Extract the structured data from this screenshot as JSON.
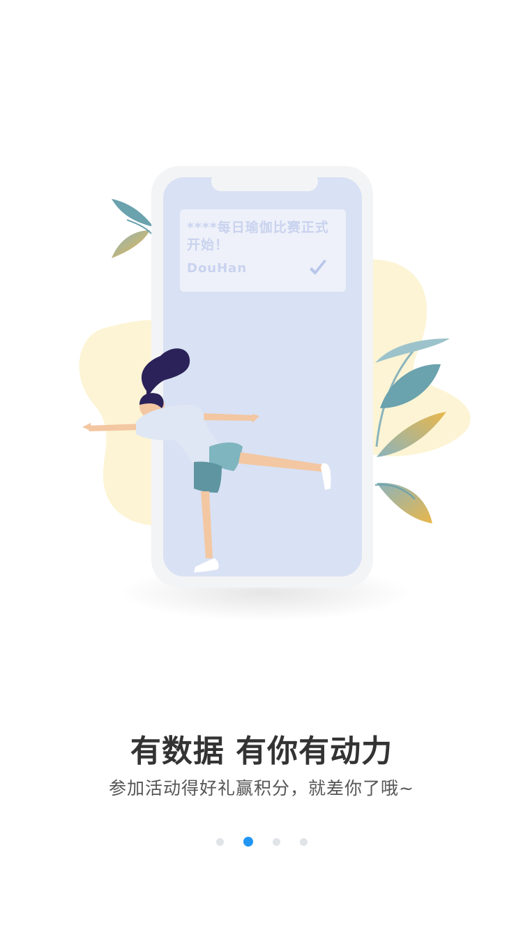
{
  "illustration": {
    "notification_message": "****每日瑜伽比赛正式开始！",
    "notification_user": "DouHan",
    "check_icon": "checkmark-icon"
  },
  "onboarding": {
    "title": "有数据 有你有动力",
    "subtitle": "参加活动得好礼赢积分，就差你了哦~"
  },
  "pagination": {
    "total": 4,
    "active_index": 1
  },
  "colors": {
    "accent": "#2196f3",
    "dot_inactive": "#e0e3e8",
    "phone_screen": "#d9e1f4",
    "blob_yellow": "#fcf4d4",
    "leaf_teal": "#6aa2ad"
  }
}
